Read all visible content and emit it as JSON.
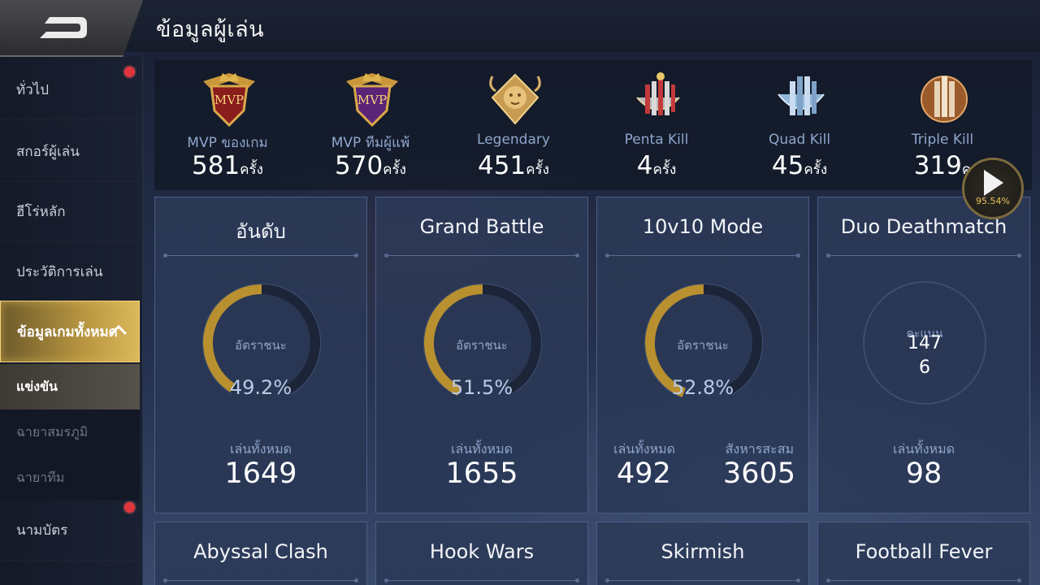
{
  "header": {
    "title": "ข้อมูลผู้เล่น"
  },
  "sidebar": {
    "items": [
      {
        "label": "ทั่วไป"
      },
      {
        "label": "สกอร์ผู้เล่น"
      },
      {
        "label": "ฮีโร่หลัก"
      },
      {
        "label": "ประวัติการเล่น"
      },
      {
        "label": "ข้อมูลเกมทั้งหมด"
      },
      {
        "label": "นามบัตร"
      }
    ],
    "sub_items": [
      {
        "label": "แข่งขัน"
      },
      {
        "label": "ฉายาสมรภูมิ"
      },
      {
        "label": "ฉายาทีม"
      }
    ]
  },
  "achievements": [
    {
      "name": "MVP ของเกม",
      "count": "581",
      "unit": "ครั้ง",
      "icon": "mvp-red-badge-icon"
    },
    {
      "name": "MVP ทีมผู้แพ้",
      "count": "570",
      "unit": "ครั้ง",
      "icon": "mvp-purple-badge-icon"
    },
    {
      "name": "Legendary",
      "count": "451",
      "unit": "ครั้ง",
      "icon": "legendary-lion-badge-icon"
    },
    {
      "name": "Penta Kill",
      "count": "4",
      "unit": "ครั้ง",
      "icon": "penta-kill-swords-icon"
    },
    {
      "name": "Quad Kill",
      "count": "45",
      "unit": "ครั้ง",
      "icon": "quad-kill-swords-icon"
    },
    {
      "name": "Triple Kill",
      "count": "319",
      "unit": "ค",
      "icon": "triple-kill-swords-icon"
    }
  ],
  "play_button": {
    "percent": "95.54%"
  },
  "cards": [
    {
      "title": "อันดับ",
      "gauge_label": "อัตราชนะ",
      "win_rate": "49.2%",
      "win_fraction": 0.492,
      "stat1_label": "เล่นทั้งหมด",
      "stat1_value": "1649"
    },
    {
      "title": "Grand Battle",
      "gauge_label": "อัตราชนะ",
      "win_rate": "51.5%",
      "win_fraction": 0.515,
      "stat1_label": "เล่นทั้งหมด",
      "stat1_value": "1655"
    },
    {
      "title": "10v10 Mode",
      "gauge_label": "อัตราชนะ",
      "win_rate": "52.8%",
      "win_fraction": 0.528,
      "stat1_label": "เล่นทั้งหมด",
      "stat1_value": "492",
      "stat2_label": "สังหารสะสม",
      "stat2_value": "3605"
    },
    {
      "title": "Duo Deathmatch",
      "score_label": "คะแนน",
      "score_line1": "147",
      "score_line2": "6",
      "stat1_label": "เล่นทั้งหมด",
      "stat1_value": "98"
    }
  ],
  "bottom_cards": [
    {
      "title": "Abyssal Clash"
    },
    {
      "title": "Hook Wars"
    },
    {
      "title": "Skirmish"
    },
    {
      "title": "Football Fever"
    }
  ],
  "colors": {
    "gauge_gold": "#b8902f",
    "gauge_track": "#1c2438",
    "accent": "#e9c25a",
    "notify": "#e0353d"
  }
}
